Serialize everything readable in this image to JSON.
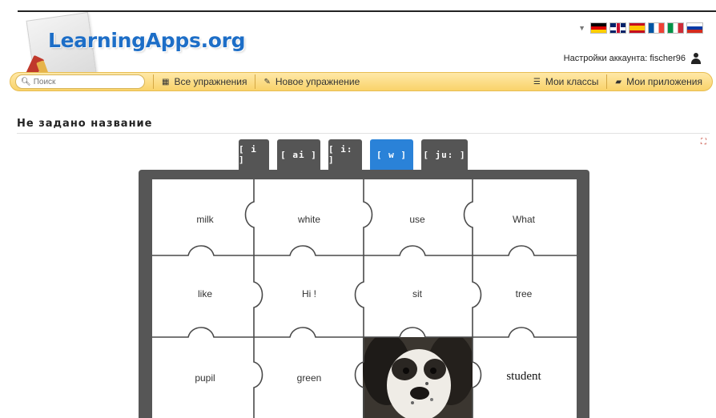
{
  "header": {
    "logo_text": "LearningApps.org",
    "account_label": "Настройки аккаунта: fischer96",
    "languages": [
      "de",
      "en",
      "es",
      "fr",
      "it",
      "ru"
    ]
  },
  "navbar": {
    "search_placeholder": "Поиск",
    "items": [
      {
        "label": "Все упражнения",
        "icon": "grid-icon"
      },
      {
        "label": "Новое упражнение",
        "icon": "pencil-icon"
      },
      {
        "label": "Мои классы",
        "icon": "list-icon"
      },
      {
        "label": "Мои приложения",
        "icon": "folder-icon"
      }
    ]
  },
  "page": {
    "title": "Не задано название"
  },
  "tabs": [
    {
      "label": "[ i ]",
      "active": false
    },
    {
      "label": "[ ai ]",
      "active": false
    },
    {
      "label": "[ i: ]",
      "active": false
    },
    {
      "label": "[ w ]",
      "active": true
    },
    {
      "label": "[ ju: ]",
      "active": false
    }
  ],
  "puzzle": {
    "cells": [
      [
        "milk",
        "white",
        "use",
        "What"
      ],
      [
        "like",
        "Hi !",
        "sit",
        "tree"
      ],
      [
        "pupil",
        "green",
        "",
        "student"
      ]
    ],
    "photo_cell": "dog-photo"
  },
  "colors": {
    "accent": "#2a82d8",
    "tab": "#555555",
    "frame": "#565656",
    "navbar": "#f9d36a",
    "logo": "#1d6ec7"
  }
}
